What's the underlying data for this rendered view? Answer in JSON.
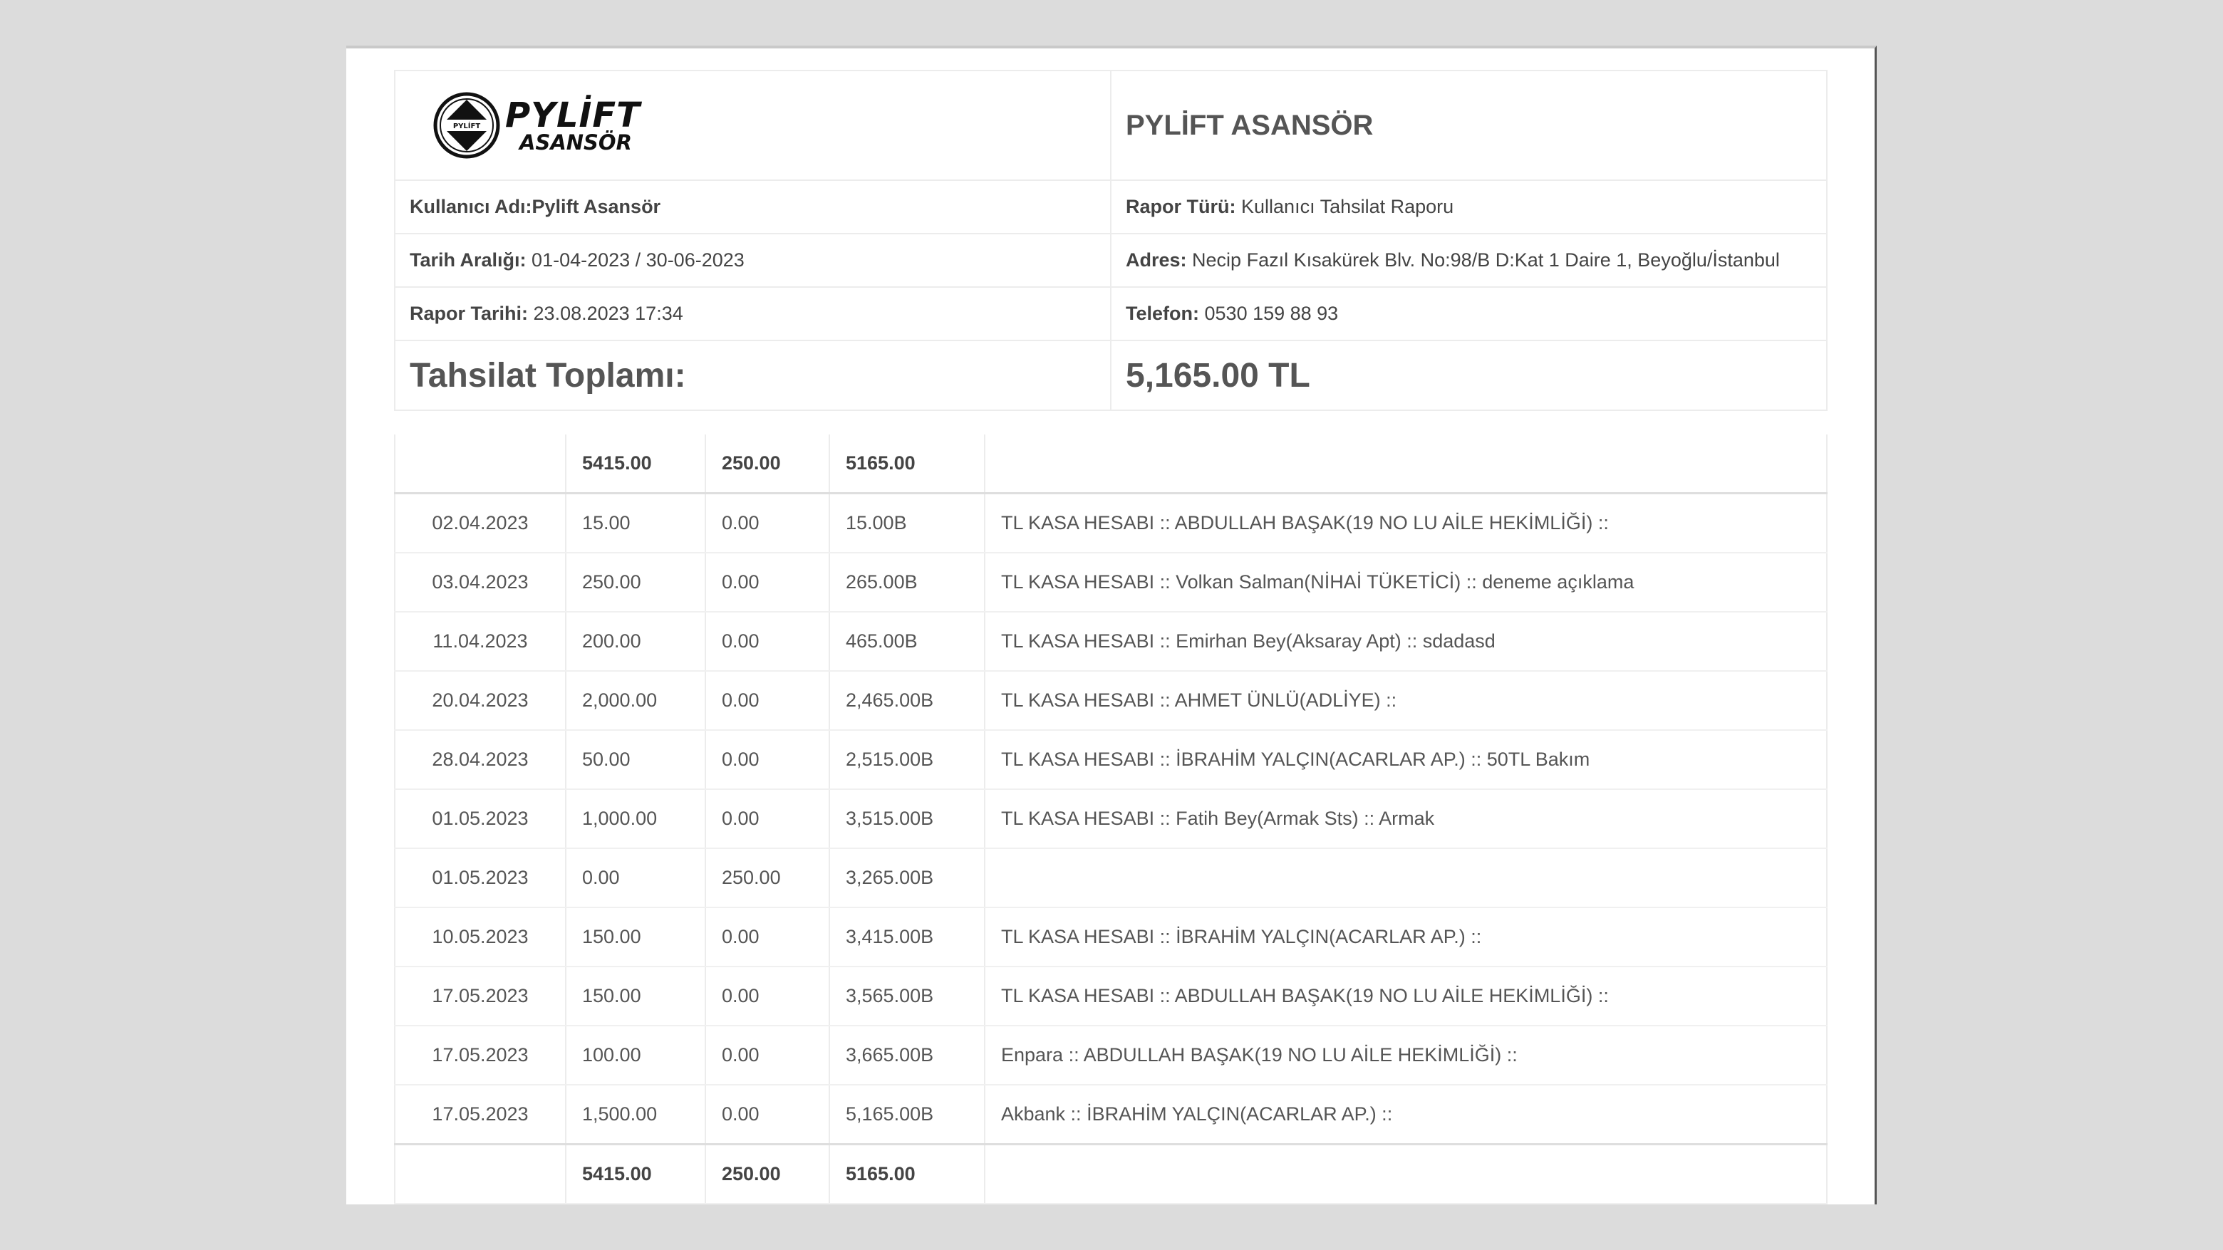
{
  "company": {
    "logo_brand": "PYLİFT",
    "logo_sub": "ASANSÖR",
    "logo_emblem_text": "PYLİFT",
    "name": "PYLİFT ASANSÖR"
  },
  "info": {
    "user_label": "Kullanıcı Adı:",
    "user_value": "Pylift Asansör",
    "report_type_label": "Rapor Türü:",
    "report_type_value": "Kullanıcı Tahsilat Raporu",
    "date_range_label": "Tarih Aralığı:",
    "date_range_value": "01-04-2023 / 30-06-2023",
    "address_label": "Adres:",
    "address_value": "Necip Fazıl Kısakürek Blv. No:98/B D:Kat 1 Daire 1, Beyoğlu/İstanbul",
    "report_date_label": "Rapor Tarihi:",
    "report_date_value": "23.08.2023 17:34",
    "phone_label": "Telefon:",
    "phone_value": "0530 159 88 93"
  },
  "total": {
    "label": "Tahsilat Toplamı:",
    "value": "5,165.00 TL"
  },
  "summary": {
    "debit": "5415.00",
    "credit": "250.00",
    "balance": "5165.00"
  },
  "rows": [
    {
      "date": "02.04.2023",
      "debit": "15.00",
      "credit": "0.00",
      "balance": "15.00B",
      "desc": "TL KASA HESABI :: ABDULLAH BAŞAK(19 NO LU AİLE HEKİMLİĞİ) ::"
    },
    {
      "date": "03.04.2023",
      "debit": "250.00",
      "credit": "0.00",
      "balance": "265.00B",
      "desc": "TL KASA HESABI :: Volkan Salman(NİHAİ TÜKETİCİ) :: deneme açıklama"
    },
    {
      "date": "11.04.2023",
      "debit": "200.00",
      "credit": "0.00",
      "balance": "465.00B",
      "desc": "TL KASA HESABI :: Emirhan Bey(Aksaray Apt) :: sdadasd"
    },
    {
      "date": "20.04.2023",
      "debit": "2,000.00",
      "credit": "0.00",
      "balance": "2,465.00B",
      "desc": "TL KASA HESABI :: AHMET ÜNLÜ(ADLİYE) ::"
    },
    {
      "date": "28.04.2023",
      "debit": "50.00",
      "credit": "0.00",
      "balance": "2,515.00B",
      "desc": "TL KASA HESABI :: İBRAHİM YALÇIN(ACARLAR AP.) :: 50TL Bakım"
    },
    {
      "date": "01.05.2023",
      "debit": "1,000.00",
      "credit": "0.00",
      "balance": "3,515.00B",
      "desc": "TL KASA HESABI :: Fatih Bey(Armak Sts) :: Armak"
    },
    {
      "date": "01.05.2023",
      "debit": "0.00",
      "credit": "250.00",
      "balance": "3,265.00B",
      "desc": ""
    },
    {
      "date": "10.05.2023",
      "debit": "150.00",
      "credit": "0.00",
      "balance": "3,415.00B",
      "desc": "TL KASA HESABI :: İBRAHİM YALÇIN(ACARLAR AP.) ::"
    },
    {
      "date": "17.05.2023",
      "debit": "150.00",
      "credit": "0.00",
      "balance": "3,565.00B",
      "desc": "TL KASA HESABI :: ABDULLAH BAŞAK(19 NO LU AİLE HEKİMLİĞİ) ::"
    },
    {
      "date": "17.05.2023",
      "debit": "100.00",
      "credit": "0.00",
      "balance": "3,665.00B",
      "desc": "Enpara :: ABDULLAH BAŞAK(19 NO LU AİLE HEKİMLİĞİ) ::"
    },
    {
      "date": "17.05.2023",
      "debit": "1,500.00",
      "credit": "0.00",
      "balance": "5,165.00B",
      "desc": "Akbank :: İBRAHİM YALÇIN(ACARLAR AP.) ::"
    }
  ]
}
